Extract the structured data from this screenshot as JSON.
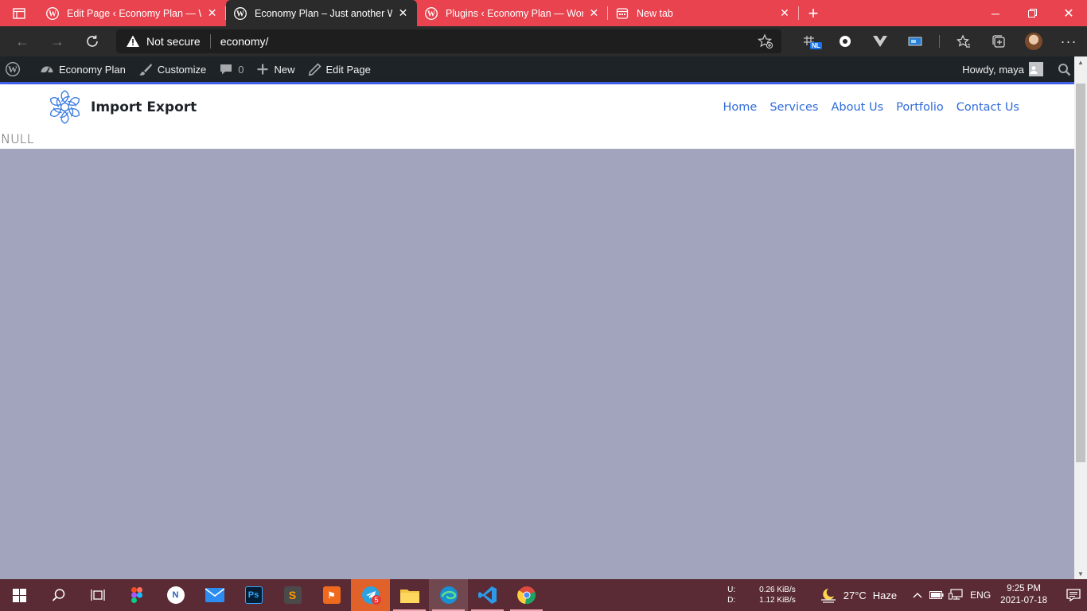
{
  "browser": {
    "tabs": [
      {
        "title": "Edit Page ‹ Economy Plan — Wo",
        "active": false
      },
      {
        "title": "Economy Plan – Just another Wo",
        "active": true
      },
      {
        "title": "Plugins ‹ Economy Plan — Word",
        "active": false
      },
      {
        "title": "New tab",
        "active": false
      }
    ],
    "security_label": "Not secure",
    "url": "economy/",
    "ext_badge": "NL"
  },
  "wp_admin_bar": {
    "site_name": "Economy Plan",
    "customize": "Customize",
    "comments_count": "0",
    "new": "New",
    "edit_page": "Edit Page",
    "howdy": "Howdy, maya"
  },
  "site": {
    "logo_text": "Import Export",
    "nav": [
      "Home",
      "Services",
      "About Us",
      "Portfolio",
      "Contact Us"
    ],
    "null_text": "NULL",
    "accent_color": "#4361ee",
    "nav_color": "#2f6bd9",
    "content_bg": "#a2a4be"
  },
  "taskbar": {
    "telegram_badge": "5",
    "net_up_label": "U:",
    "net_down_label": "D:",
    "net_up": "0.26 KiB/s",
    "net_down": "1.12 KiB/s",
    "temperature": "27°C",
    "weather": "Haze",
    "language": "ENG",
    "time": "9:25 PM",
    "date": "2021-07-18"
  },
  "colors": {
    "tab_strip": "#e8434f",
    "toolbar": "#2b2b2b",
    "wp_bar": "#1d2327",
    "taskbar": "#5a2b34"
  }
}
